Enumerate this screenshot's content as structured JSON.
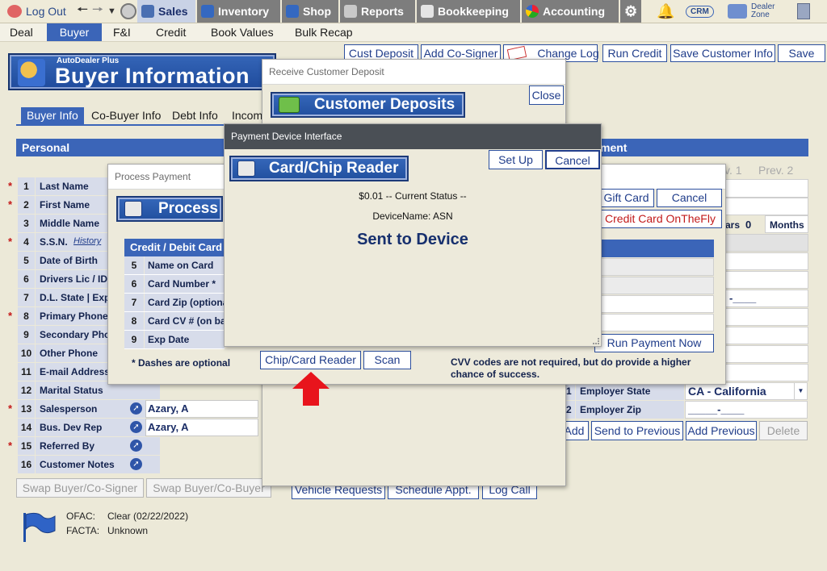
{
  "topnav": {
    "logout": "Log Out",
    "sales": "Sales",
    "inventory": "Inventory",
    "shop": "Shop",
    "reports": "Reports",
    "bookkeeping": "Bookkeeping",
    "accounting": "Accounting",
    "crm": "CRM",
    "dealer_zone_1": "Dealer",
    "dealer_zone_2": "Zone"
  },
  "subnav": [
    "Deal",
    "Buyer",
    "F&I",
    "Credit",
    "Book Values",
    "Bulk Recap"
  ],
  "actions": {
    "cust_deposit": "Cust Deposit",
    "add_cosigner": "Add Co-Signer",
    "change_log": "Change Log",
    "run_credit": "Run Credit",
    "save_customer_info": "Save Customer Info",
    "save": "Save"
  },
  "banner": {
    "small": "AutoDealer Plus",
    "title": "Buyer Information"
  },
  "buyer_tabs": [
    "Buyer Info",
    "Co-Buyer Info",
    "Debt Info",
    "Incom"
  ],
  "personal": {
    "header": "Personal",
    "rows": [
      {
        "n": "1",
        "label": "Last Name",
        "req": true,
        "value": ""
      },
      {
        "n": "2",
        "label": "First Name",
        "req": true,
        "value": ""
      },
      {
        "n": "3",
        "label": "Middle Name",
        "req": false,
        "value": ""
      },
      {
        "n": "4",
        "label": "S.S.N.",
        "req": true,
        "value": "",
        "history": "History"
      },
      {
        "n": "5",
        "label": "Date of Birth",
        "req": false,
        "value": ""
      },
      {
        "n": "6",
        "label": "Drivers Lic / ID",
        "req": false,
        "value": ""
      },
      {
        "n": "7",
        "label": "D.L. State | Exp",
        "req": false,
        "value": ""
      },
      {
        "n": "8",
        "label": "Primary Phone",
        "req": true,
        "value": ""
      },
      {
        "n": "9",
        "label": "Secondary Phone",
        "req": false,
        "value": ""
      },
      {
        "n": "10",
        "label": "Other Phone",
        "req": false,
        "value": ""
      },
      {
        "n": "11",
        "label": "E-mail Address",
        "req": false,
        "value": ""
      },
      {
        "n": "12",
        "label": "Marital Status",
        "req": false,
        "value": ""
      },
      {
        "n": "13",
        "label": "Salesperson",
        "req": true,
        "value": "Azary, A",
        "arrow": true
      },
      {
        "n": "14",
        "label": "Bus. Dev Rep",
        "req": false,
        "value": "Azary, A",
        "arrow": true
      },
      {
        "n": "15",
        "label": "Referred By",
        "req": true,
        "value": "",
        "arrow": true
      },
      {
        "n": "16",
        "label": "Customer Notes",
        "req": false,
        "value": "",
        "arrow": true
      }
    ]
  },
  "swap_buttons": [
    "Swap Buyer/Co-Signer",
    "Swap Buyer/Co-Buyer"
  ],
  "bottom_buttons": {
    "vehicle_requests": "Vehicle Requests",
    "schedule_appt": "Schedule Appt.",
    "log_call": "Log Call",
    "add": "Add",
    "send_to_previous": "Send to Previous",
    "add_previous": "Add Previous",
    "delete": "Delete"
  },
  "right": {
    "section_header": "ment",
    "prev1": "v. 1",
    "prev2": "Prev. 2",
    "years_label": "ars",
    "years_value": "0",
    "months_label": "Months",
    "zip_dash": "-____",
    "row_31_num": "1",
    "row_31_label": "Employer State",
    "row_31_value": "CA - California",
    "row_32_num": "2",
    "row_32_label": "Employer Zip",
    "row_32_value": "_____-____"
  },
  "ofac": {
    "ofac_label": "OFAC:",
    "ofac_value": "Clear  (02/22/2022)",
    "facta_label": "FACTA:",
    "facta_value": "Unknown"
  },
  "deposit_dialog": {
    "title": "Receive Customer Deposit",
    "close": "Close",
    "header": "Customer Deposits"
  },
  "process_dialog": {
    "title": "Process Payment",
    "header": "Process",
    "gift_card": "Gift Card",
    "cancel": "Cancel",
    "cc_onthefly": "Credit Card OnTheFly",
    "table_header": "Credit / Debit Card",
    "rows": [
      {
        "n": "5",
        "label": "Name on Card"
      },
      {
        "n": "6",
        "label": "Card Number *"
      },
      {
        "n": "7",
        "label": "Card Zip (optional)"
      },
      {
        "n": "8",
        "label": "Card CV # (on back)"
      },
      {
        "n": "9",
        "label": "Exp Date"
      }
    ],
    "dashes_note": "* Dashes are optional",
    "chip_reader": "Chip/Card Reader",
    "scan": "Scan",
    "run_payment": "Run Payment Now",
    "cvv_note": "CVV codes are not required, but do provide a higher chance of success."
  },
  "device_dialog": {
    "title": "Payment Device Interface",
    "header": "Card/Chip Reader",
    "setup": "Set Up",
    "cancel": "Cancel",
    "status": "$0.01 -- Current Status --",
    "device_name": "DeviceName: ASN",
    "sent": "Sent to Device"
  },
  "colors": {
    "accent": "#3b65b8",
    "arrow": "#e8141c",
    "label_bg": "#d7dcea"
  }
}
